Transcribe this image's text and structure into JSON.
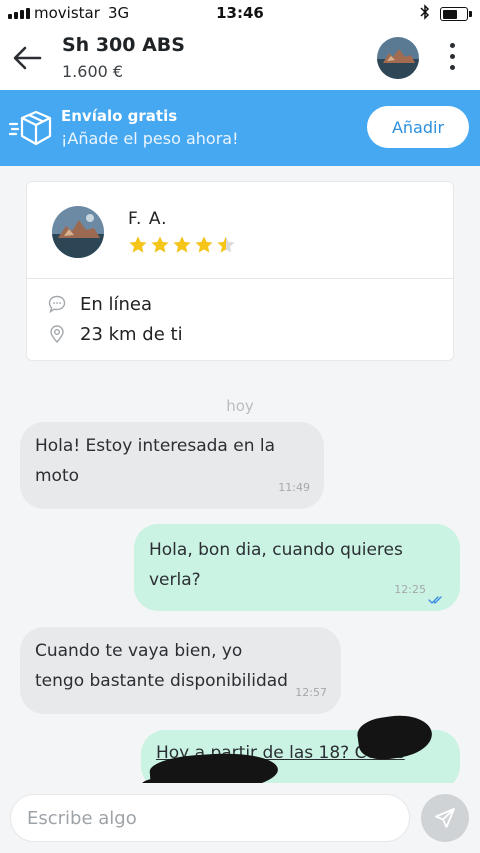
{
  "status_bar": {
    "carrier": "movistar",
    "network": "3G",
    "time": "13:46"
  },
  "header": {
    "title": "Sh 300 ABS",
    "price": "1.600 €"
  },
  "shipping_banner": {
    "title": "Envíalo gratis",
    "subtitle": "¡Añade el peso ahora!",
    "button_label": "Añadir",
    "color": "#47a8f2"
  },
  "seller": {
    "name": "F.  A.",
    "rating_stars": 4.5,
    "status": "En línea",
    "distance": "23 km de ti"
  },
  "chat": {
    "day_label": "hoy",
    "messages": [
      {
        "direction": "incoming",
        "text": "Hola! Estoy interesada en la\nmoto",
        "time": "11:49"
      },
      {
        "direction": "outgoing",
        "text": "Hola, bon dia, cuando quieres\nverla?",
        "time": "12:25",
        "read": true
      },
      {
        "direction": "incoming",
        "text": "Cuando te vaya bien, yo\ntengo bastante disponibilidad",
        "time": "12:57"
      },
      {
        "direction": "outgoing",
        "text": "Hoy a partir de las 18? Conte",
        "time": ""
      }
    ]
  },
  "compose": {
    "placeholder": "Escribe algo"
  },
  "colors": {
    "accent_blue": "#47a8f2",
    "incoming_bubble": "#e8e9eb",
    "outgoing_bubble": "#cbf3e3",
    "star": "#f5c518"
  }
}
